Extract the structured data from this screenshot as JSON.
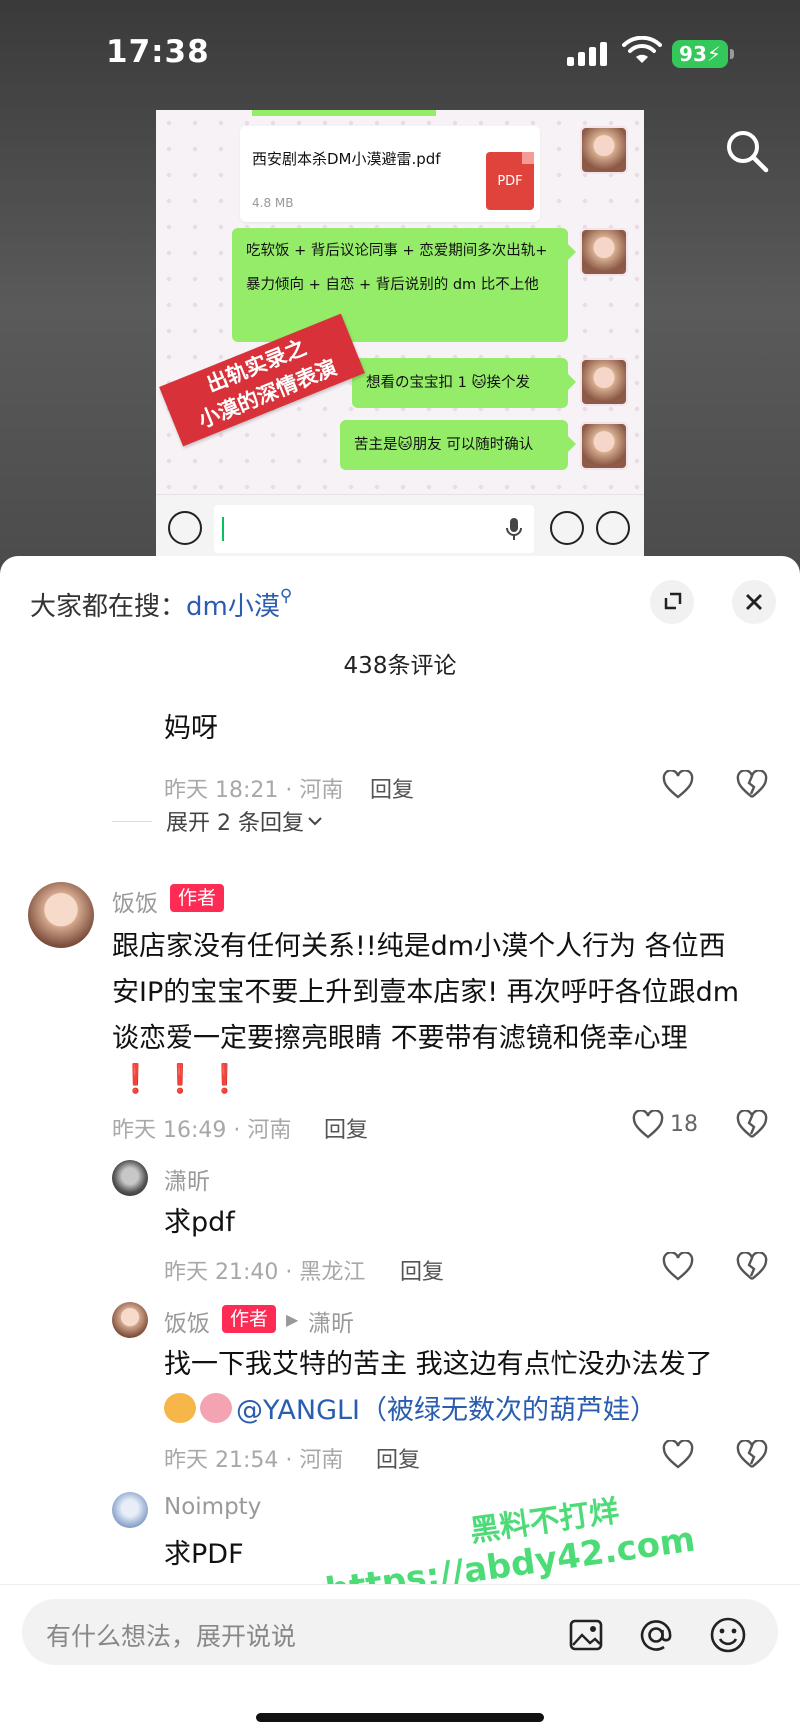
{
  "status_bar": {
    "time": "17:38",
    "battery": "93"
  },
  "video_shot": {
    "file_name": "西安剧本杀DM小漠避雷.pdf",
    "file_size": "4.8 MB",
    "file_type": "PDF",
    "message_1": "吃软饭 + 背后议论同事 + 恋爱期间多次出轨+ 暴力倾向 + 自恋 + 背后说别的 dm 比不上他",
    "message_2": "想看の宝宝扣 1 🐱挨个发",
    "message_3": "苦主是🐱朋友 可以随时确认",
    "stamp_line_1": "出轨实录之",
    "stamp_line_2": "小漠的深情表演"
  },
  "sheet": {
    "hot_search_prefix": "大家都在搜：",
    "hot_search_keyword": "dm小漠",
    "comments_count": "438条评论"
  },
  "comments": {
    "c0": {
      "text": "妈呀",
      "meta": "昨天 18:21 · 河南",
      "reply": "回复"
    },
    "expand_replies": "展开 2 条回复",
    "c1": {
      "name": "饭饭",
      "tag": "作者",
      "text_line_1": "跟店家没有任何关系!!纯是dm小漠个人行为 各位西",
      "text_line_2": "安IP的宝宝不要上升到壹本店家! 再次呼吁各位跟dm",
      "text_line_3": "谈恋爱一定要擦亮眼睛 不要带有滤镜和侥幸心理",
      "excl": "❗ ❗ ❗",
      "meta": "昨天 16:49 · 河南",
      "reply": "回复",
      "likes": "18"
    },
    "r1": {
      "name": "潇昕",
      "text": "求pdf",
      "meta": "昨天 21:40 · 黑龙江",
      "reply": "回复"
    },
    "r2": {
      "name": "饭饭",
      "tag": "作者",
      "to": "潇昕",
      "text_line_1": "找一下我艾特的苦主 我这边有点忙没办法发了",
      "mention": "@YANGLI（被绿无数次的葫芦娃）",
      "meta": "昨天 21:54 · 河南",
      "reply": "回复"
    },
    "r3": {
      "name": "Noimpty",
      "text": "求PDF"
    }
  },
  "watermark": {
    "line_1": "黑料不打烊",
    "line_2": "https://abdy42.com"
  },
  "bottom_bar": {
    "placeholder": "有什么想法，展开说说"
  },
  "colors": {
    "accent": "#fe2c55",
    "wechat_green": "#95ec69",
    "link": "#2a5db0"
  }
}
